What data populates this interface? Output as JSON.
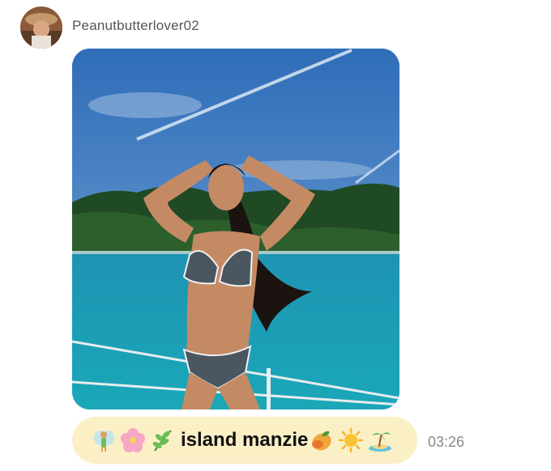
{
  "message": {
    "sender": {
      "username": "Peanutbutterlover02",
      "avatar_icon": "profile-photo-avatar"
    },
    "attachment": {
      "type": "photo",
      "content": "woman in bikini on boat deck, turquoise sea, green hills, blue sky with contrail"
    },
    "reply": {
      "emojis_before": [
        "fairy",
        "cherry-blossom",
        "herb"
      ],
      "text": "island manzie",
      "emojis_after": [
        "mango",
        "sun",
        "desert-island"
      ]
    },
    "time": "03:26"
  },
  "colors": {
    "bubble": "#fbefc6",
    "username": "#555555",
    "timestamp": "#8a8a8a",
    "sea": "#1a9fb0",
    "sky": "#4a82c4"
  }
}
